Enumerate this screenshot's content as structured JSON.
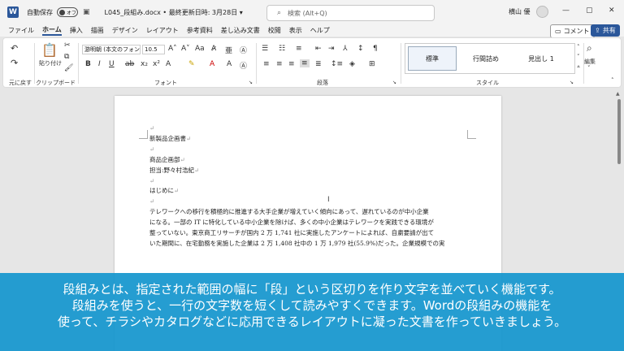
{
  "titlebar": {
    "app_icon": "W",
    "autosave_label": "自動保存",
    "autosave_state": "オフ",
    "doc_title": "L045_段組み.docx • 最終更新日時: 3月28日 ▾",
    "search_placeholder": "検索 (Alt+Q)",
    "user_name": "横山 優",
    "buttons": {
      "minimize": "—",
      "restore": "▢",
      "close": "✕"
    }
  },
  "menu": {
    "items": [
      "ファイル",
      "ホーム",
      "挿入",
      "描画",
      "デザイン",
      "レイアウト",
      "参考資料",
      "差し込み文書",
      "校閲",
      "表示",
      "ヘルプ"
    ],
    "comment_label": "コメント",
    "share_label": "共有"
  },
  "ribbon": {
    "undo_group_label": "元に戻す",
    "clipboard": {
      "paste_label": "貼り付け",
      "group_label": "クリップボード"
    },
    "font": {
      "font_name": "游明朝 (本文のフォン",
      "font_size": "10.5",
      "group_label": "フォント"
    },
    "paragraph_label": "段落",
    "styles": {
      "items": [
        "標準",
        "行間詰め",
        "見出し 1"
      ],
      "group_label": "スタイル"
    },
    "edit_label": "編集"
  },
  "document": {
    "lines": [
      "",
      "新製品企画書",
      "",
      "商品企画部",
      "担当:野々村浩紀",
      "",
      "はじめに",
      "",
      "テレワークへの移行を積極的に推進する大手企業が増えていく傾向にあって、遅れているのが中小企業",
      "になる。一部の IT に特化している中小企業を除けば、多くの中小企業はテレワークを実践できる環境が",
      "整っていない。東京商工リサーチが国内 2 万 1,741 社に実施したアンケートによれば、自粛要請が出て",
      "いた期間に、在宅勤務を実施した企業は 2 万 1,408 社中の 1 万 1,979 社(55.9%)だった。企業規模での実"
    ],
    "paragraph_mark": "↵"
  },
  "caption": {
    "lines": [
      "段組みとは、指定された範囲の幅に「段」という区切りを作り文字を並べていく機能です。",
      "段組みを使うと、一行の文字数を短くして読みやすくできます。Wordの段組みの機能を",
      "使って、チラシやカタログなどに応用できるレイアウトに凝った文書を作っていきましょう。"
    ]
  },
  "colors": {
    "accent": "#2b579a",
    "caption_bg": "#1496cd"
  }
}
